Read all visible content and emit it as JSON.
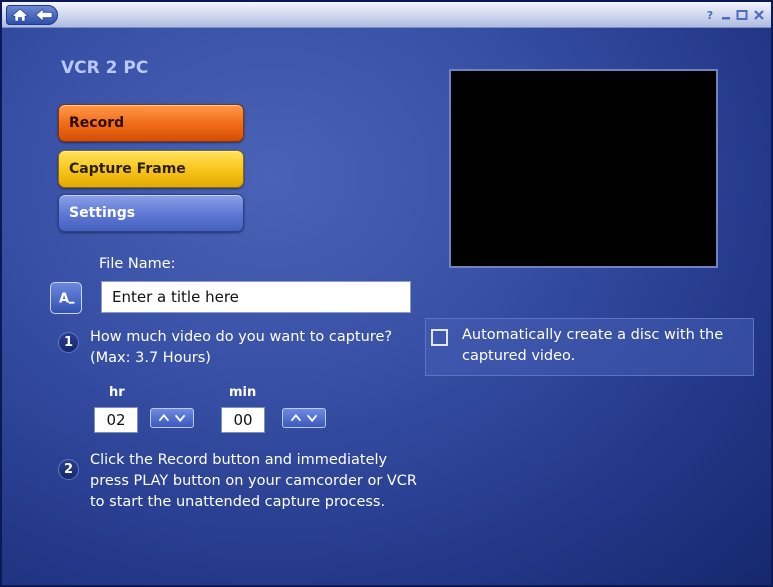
{
  "app": {
    "title": "VCR 2 PC"
  },
  "titlebar": {
    "home_icon": "home-icon",
    "back_icon": "back-arrow-icon",
    "controls": [
      "help-icon",
      "minimize-icon",
      "maximize-icon",
      "close-icon"
    ]
  },
  "menu": {
    "record_label": "Record",
    "capture_label": "Capture Frame",
    "settings_label": "Settings"
  },
  "file": {
    "label": "File Name:",
    "value": "Enter a title here",
    "icon": "text-entry-icon"
  },
  "step1": {
    "number": "1",
    "text": "How much video do you want to capture? (Max: 3.7 Hours)"
  },
  "duration": {
    "hr_label": "hr",
    "hr_value": "02",
    "min_label": "min",
    "min_value": "00"
  },
  "step2": {
    "number": "2",
    "text": "Click the Record button and immediately press PLAY button on your camcorder or VCR to start the unattended capture process."
  },
  "disc": {
    "checked": false,
    "text": "Automatically create a disc with the captured video."
  },
  "colors": {
    "background": "#3851a6",
    "record": "#f06a17",
    "capture": "#f8c418",
    "settings": "#5d77d3",
    "title_text": "#b9c9ff"
  }
}
